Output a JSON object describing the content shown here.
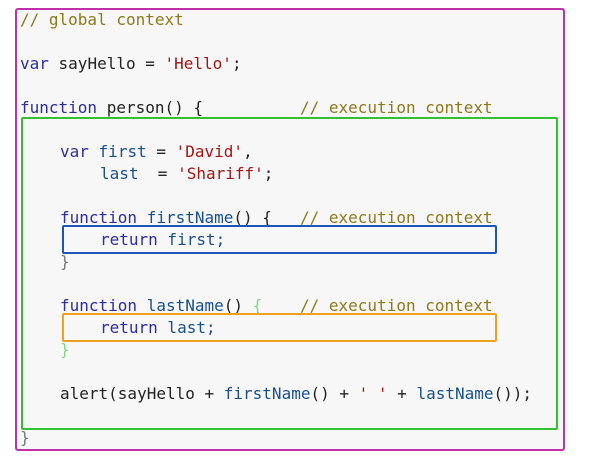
{
  "code": {
    "l1_comment": "// global context",
    "l3_var": "var",
    "l3_rest": " sayHello = ",
    "l3_str": "'Hello'",
    "l3_end": ";",
    "l5_function": "function",
    "l5_rest": " person() {",
    "l5_comment": "// execution context",
    "l7_var": "var",
    "l7_first": "first",
    "l7_eq": " = ",
    "l7_str": "'David'",
    "l7_end": ",",
    "l8_last": "last",
    "l8_eq": "  = ",
    "l8_str": "'Shariff'",
    "l8_end": ";",
    "l10_function": "function",
    "l10_name": "firstName",
    "l10_rest": "() {",
    "l10_comment": "// execution context",
    "l11_return": "return",
    "l11_rest": " first;",
    "l12_brace": "}",
    "l14_function": "function",
    "l14_name": "lastName",
    "l14_rest": "() ",
    "l14_brace": "{",
    "l14_comment": "// execution context",
    "l15_return": "return",
    "l15_rest": " last;",
    "l16_brace": "}",
    "l18_call": "alert(sayHello + ",
    "l18_fn1": "firstName",
    "l18_mid": "() + ",
    "l18_str": "' '",
    "l18_plus": " + ",
    "l18_fn2": "lastName",
    "l18_end": "());",
    "l20_brace": "}"
  },
  "colors": {
    "global_context": "#c030a8",
    "person_context": "#33c033",
    "firstname_context": "#1f55b8",
    "lastname_context": "#f0a020"
  }
}
